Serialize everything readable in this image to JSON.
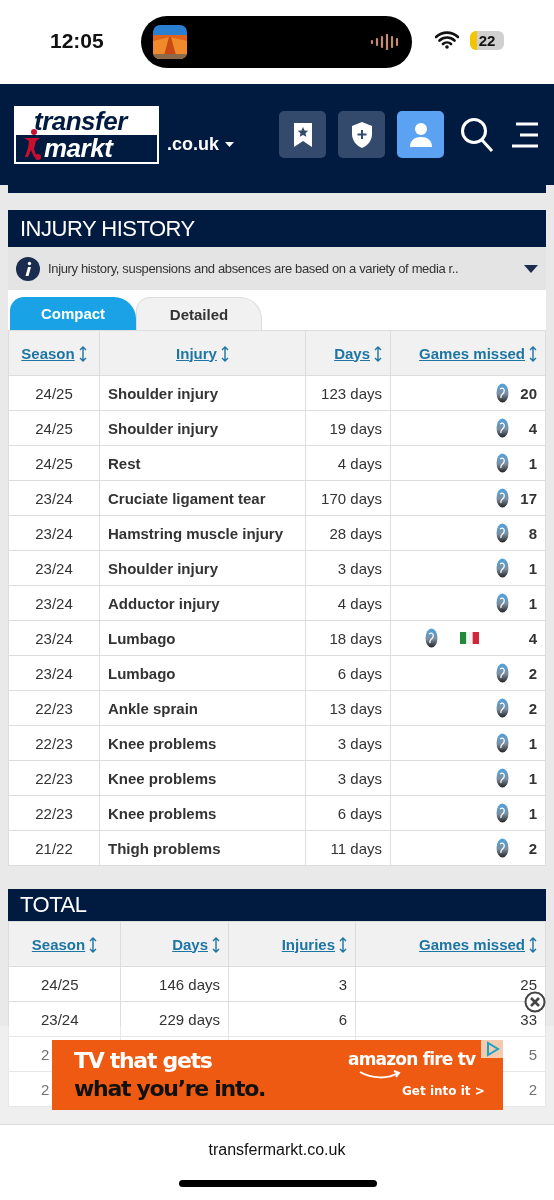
{
  "status_bar": {
    "time": "12:05",
    "battery": "22"
  },
  "header": {
    "logo": [
      "transfer",
      "markt"
    ],
    "domain": ".co.uk"
  },
  "injury_history": {
    "title": "INJURY HISTORY",
    "info": "Injury history, suspensions and absences are based on a variety of media r..",
    "tabs": [
      {
        "label": "Compact",
        "selected": true
      },
      {
        "label": "Detailed",
        "selected": false
      }
    ],
    "columns": [
      "Season",
      "Injury",
      "Days",
      "Games missed"
    ],
    "rows": [
      {
        "season": "24/25",
        "injury": "Shoulder injury",
        "days": "123 days",
        "games_missed": "20",
        "national_team": false
      },
      {
        "season": "24/25",
        "injury": "Shoulder injury",
        "days": "19 days",
        "games_missed": "4",
        "national_team": false
      },
      {
        "season": "24/25",
        "injury": "Rest",
        "days": "4 days",
        "games_missed": "1",
        "national_team": false
      },
      {
        "season": "23/24",
        "injury": "Cruciate ligament tear",
        "days": "170 days",
        "games_missed": "17",
        "national_team": false
      },
      {
        "season": "23/24",
        "injury": "Hamstring muscle injury",
        "days": "28 days",
        "games_missed": "8",
        "national_team": false
      },
      {
        "season": "23/24",
        "injury": "Shoulder injury",
        "days": "3 days",
        "games_missed": "1",
        "national_team": false
      },
      {
        "season": "23/24",
        "injury": "Adductor injury",
        "days": "4 days",
        "games_missed": "1",
        "national_team": false
      },
      {
        "season": "23/24",
        "injury": "Lumbago",
        "days": "18 days",
        "games_missed": "4",
        "national_team": true
      },
      {
        "season": "23/24",
        "injury": "Lumbago",
        "days": "6 days",
        "games_missed": "2",
        "national_team": false
      },
      {
        "season": "22/23",
        "injury": "Ankle sprain",
        "days": "13 days",
        "games_missed": "2",
        "national_team": false
      },
      {
        "season": "22/23",
        "injury": "Knee problems",
        "days": "3 days",
        "games_missed": "1",
        "national_team": false
      },
      {
        "season": "22/23",
        "injury": "Knee problems",
        "days": "3 days",
        "games_missed": "1",
        "national_team": false
      },
      {
        "season": "22/23",
        "injury": "Knee problems",
        "days": "6 days",
        "games_missed": "1",
        "national_team": false
      },
      {
        "season": "21/22",
        "injury": "Thigh problems",
        "days": "11 days",
        "games_missed": "2",
        "national_team": false
      }
    ]
  },
  "total": {
    "title": "TOTAL",
    "columns": [
      "Season",
      "Days",
      "Injuries",
      "Games missed"
    ],
    "rows": [
      {
        "season": "24/25",
        "days": "146 days",
        "injuries": "3",
        "games_missed": "25"
      },
      {
        "season": "23/24",
        "days": "229 days",
        "injuries": "6",
        "games_missed": "33"
      },
      {
        "season": "2",
        "games_missed": "5"
      },
      {
        "season": "2",
        "games_missed": "2"
      }
    ]
  },
  "ad": {
    "headline": "TV that gets",
    "subline": "what you’re into.",
    "brand": "amazon fire tv",
    "cta": "Get into it >"
  },
  "browser": {
    "url": "transfermarkt.co.uk"
  }
}
